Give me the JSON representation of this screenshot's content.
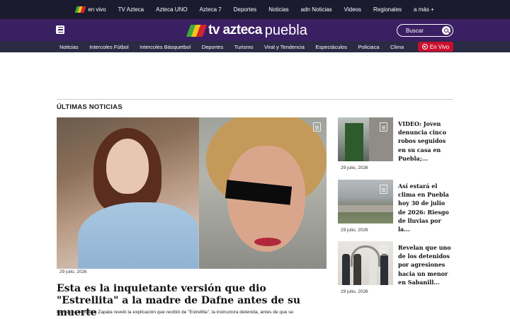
{
  "topbar": {
    "items": [
      "en vivo",
      "TV Azteca",
      "Azteca UNO",
      "Azteca 7",
      "Deportes",
      "Noticias",
      "adn Noticias",
      "Videos",
      "Regionales",
      "a más +"
    ]
  },
  "brand": {
    "logo_text": "tv azteca",
    "city": "puebla",
    "search_placeholder": "Buscar",
    "colors": {
      "bg": "#3b1f63",
      "accent_green": "#3ea83a",
      "accent_yellow": "#f3c21c",
      "accent_red": "#d3232f"
    }
  },
  "nav": {
    "items": [
      "Noticias",
      "Intercoles Fútbol",
      "Intercoles Básquetbol",
      "Deportes",
      "Turismo",
      "Viral y Tendencia",
      "Espectáculos",
      "Policiaca",
      "Clima"
    ],
    "live_label": "En Vivo",
    "live_color": "#c8102e"
  },
  "main": {
    "section_title": "ÚLTIMAS NOTICIAS",
    "hero": {
      "date": "29 julio, 2026",
      "title": "Esta es la inquietante versión que dio \"Estrellita\" a la madre de Dafne antes de su muerte",
      "summary": "La madre de Dafne Zapata reveló la explicación que recibió de \"Estrellita\", la instructora detenida, antes de que se"
    },
    "side": [
      {
        "title": "VIDEO: Joven denuncia cinco robos seguidos en su casa en Puebla;...",
        "date": "29 julio, 2026"
      },
      {
        "title": "Así estará el clima en Puebla hoy 30 de julio de 2026: Riesgo de lluvias por la...",
        "date": "29 julio, 2026"
      },
      {
        "title": "Revelan que uno de los detenidos por agresiones hacia un menor en Sabanill...",
        "date": "29 julio, 2026"
      }
    ]
  }
}
